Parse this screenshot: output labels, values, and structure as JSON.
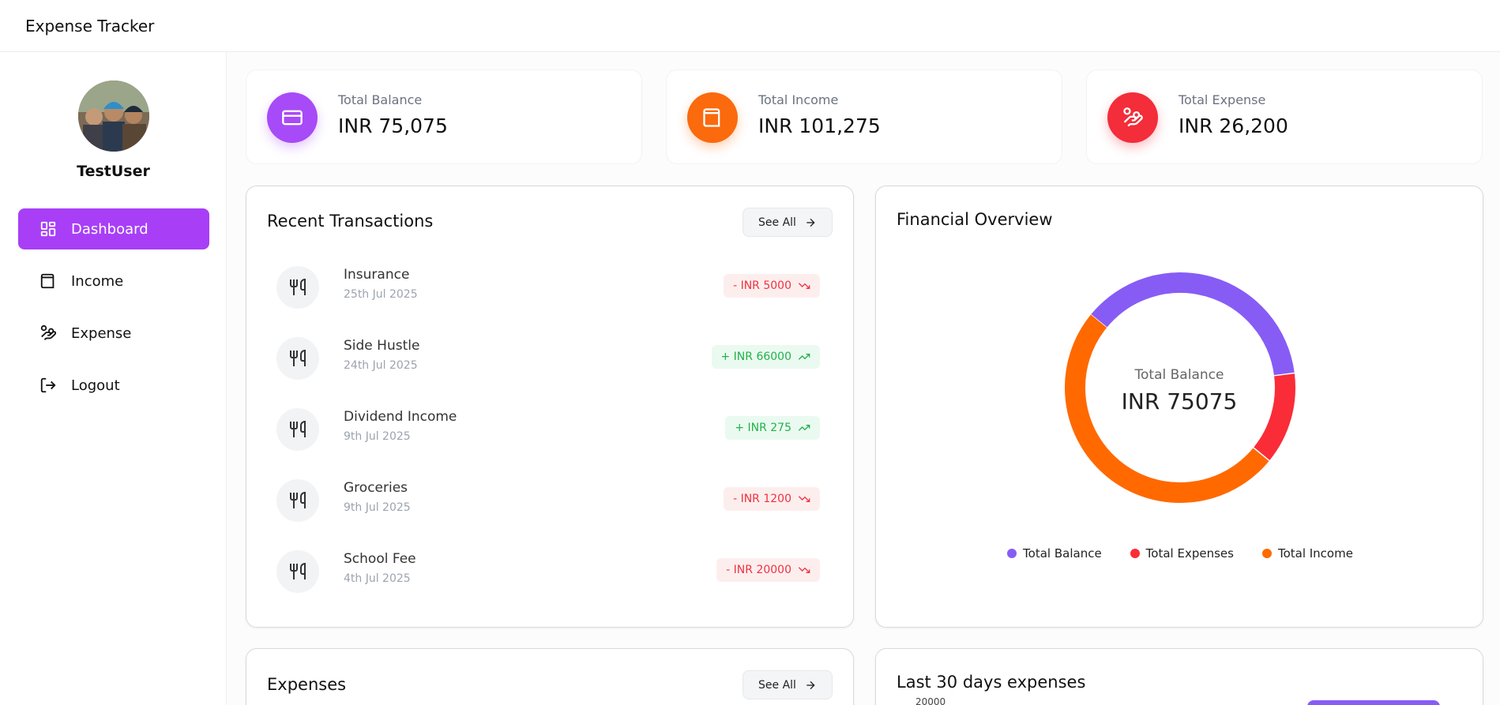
{
  "app": {
    "title": "Expense Tracker"
  },
  "user": {
    "name": "TestUser"
  },
  "nav": [
    {
      "label": "Dashboard",
      "icon": "dashboard-icon",
      "active": true
    },
    {
      "label": "Income",
      "icon": "wallet-icon",
      "active": false
    },
    {
      "label": "Expense",
      "icon": "hand-coins-icon",
      "active": false
    },
    {
      "label": "Logout",
      "icon": "logout-icon",
      "active": false
    }
  ],
  "stats": [
    {
      "label": "Total Balance",
      "value": "INR 75,075",
      "color": "#a74af8",
      "icon": "credit-card-icon"
    },
    {
      "label": "Total Income",
      "value": "INR 101,275",
      "color": "#fb6a0d",
      "icon": "wallet-icon"
    },
    {
      "label": "Total Expense",
      "value": "INR 26,200",
      "color": "#f32d3a",
      "icon": "hand-coins-icon"
    }
  ],
  "recent": {
    "title": "Recent Transactions",
    "see_all": "See All",
    "items": [
      {
        "name": "Insurance",
        "date": "25th Jul 2025",
        "amount": "- INR 5000",
        "type": "expense"
      },
      {
        "name": "Side Hustle",
        "date": "24th Jul 2025",
        "amount": "+ INR 66000",
        "type": "income"
      },
      {
        "name": "Dividend Income",
        "date": "9th Jul 2025",
        "amount": "+ INR 275",
        "type": "income"
      },
      {
        "name": "Groceries",
        "date": "9th Jul 2025",
        "amount": "- INR 1200",
        "type": "expense"
      },
      {
        "name": "School Fee",
        "date": "4th Jul 2025",
        "amount": "- INR 20000",
        "type": "expense"
      }
    ]
  },
  "overview": {
    "title": "Financial Overview",
    "center_label": "Total Balance",
    "center_value": "INR 75075"
  },
  "chart_data": {
    "type": "pie",
    "donut": true,
    "categories": [
      "Total Balance",
      "Total Expenses",
      "Total Income"
    ],
    "values": [
      75075,
      26200,
      101275
    ],
    "colors": [
      "#875cf5",
      "#fa2c37",
      "#ff6900"
    ],
    "legend_position": "bottom"
  },
  "expenses": {
    "title": "Expenses",
    "see_all": "See All"
  },
  "last30": {
    "title": "Last 30 days expenses",
    "y_tick": "20000"
  }
}
